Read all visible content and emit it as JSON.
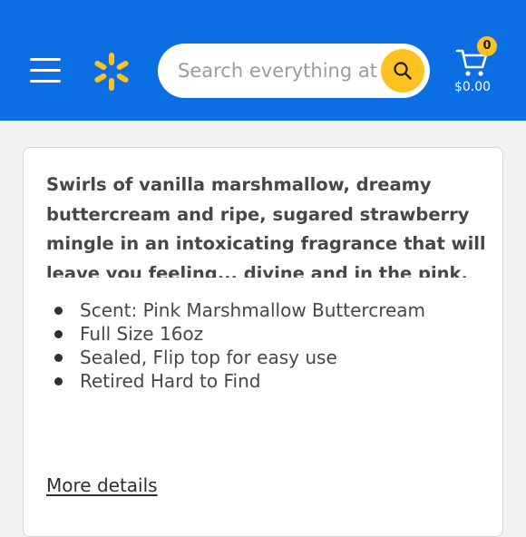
{
  "header": {
    "background_color": "#0c6ee3",
    "menu_icon": "hamburger-menu-icon",
    "logo_icon": "walmart-spark-logo",
    "logo_color": "#ffc220",
    "search": {
      "placeholder": "Search everything at Walmart online and in store",
      "button_icon": "search-icon",
      "button_color": "#ffc220"
    },
    "cart": {
      "icon": "cart-icon",
      "count": "0",
      "total": "$0.00"
    }
  },
  "product": {
    "description": "Swirls of vanilla marshmallow, dreamy buttercream and ripe, sugared strawberry mingle in an intoxicating fragrance that will leave you feeling... divine and in the pink, no matter which color",
    "features": [
      "Scent: Pink Marshmallow Buttercream",
      "Full Size 16oz",
      "Sealed, Flip top for easy use",
      "Retired Hard to Find"
    ],
    "more_details_label": "More details"
  }
}
